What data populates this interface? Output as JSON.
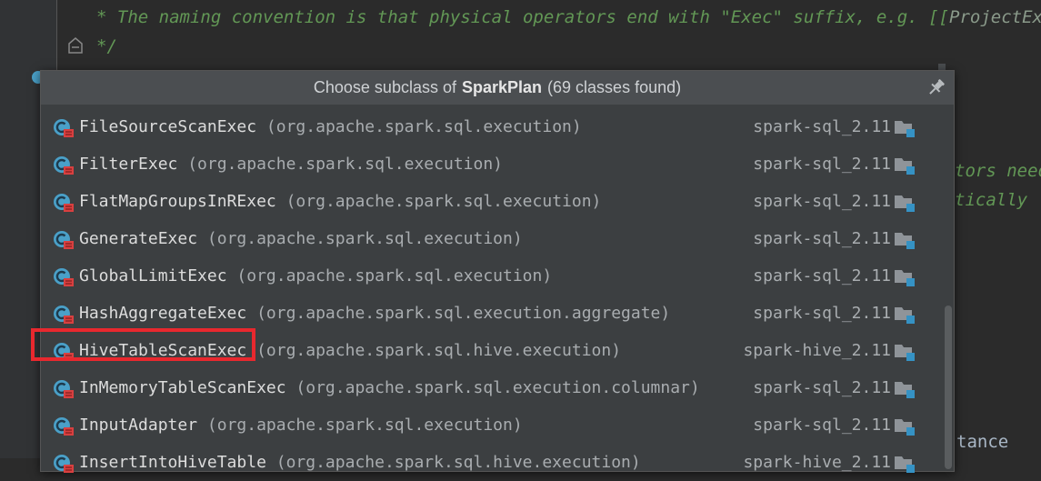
{
  "editor": {
    "line1_prefix": "* The naming convention is that physical operators end with \"Exec\" suffix, e.g. [[",
    "line1_ref": "ProjectExec]",
    "line2": "*/",
    "bg_fragment_1": "tors need",
    "bg_fragment_2": "tically",
    "bg_fragment_3": "tance"
  },
  "popup": {
    "title_prefix": "Choose subclass of",
    "title_class": "SparkPlan",
    "title_suffix": "(69 classes found)",
    "items": [
      {
        "name": "FileSourceScanExec",
        "package": "(org.apache.spark.sql.execution)",
        "module": "spark-sql_2.11"
      },
      {
        "name": "FilterExec",
        "package": "(org.apache.spark.sql.execution)",
        "module": "spark-sql_2.11"
      },
      {
        "name": "FlatMapGroupsInRExec",
        "package": "(org.apache.spark.sql.execution)",
        "module": "spark-sql_2.11"
      },
      {
        "name": "GenerateExec",
        "package": "(org.apache.spark.sql.execution)",
        "module": "spark-sql_2.11"
      },
      {
        "name": "GlobalLimitExec",
        "package": "(org.apache.spark.sql.execution)",
        "module": "spark-sql_2.11"
      },
      {
        "name": "HashAggregateExec",
        "package": "(org.apache.spark.sql.execution.aggregate)",
        "module": "spark-sql_2.11"
      },
      {
        "name": "HiveTableScanExec",
        "package": "(org.apache.spark.sql.hive.execution)",
        "module": "spark-hive_2.11"
      },
      {
        "name": "InMemoryTableScanExec",
        "package": "(org.apache.spark.sql.execution.columnar)",
        "module": "spark-sql_2.11"
      },
      {
        "name": "InputAdapter",
        "package": "(org.apache.spark.sql.execution)",
        "module": "spark-sql_2.11"
      },
      {
        "name": "InsertIntoHiveTable",
        "package": "(org.apache.spark.sql.hive.execution)",
        "module": "spark-hive_2.11"
      }
    ],
    "highlighted_item": "HiveTableScanExec",
    "icons": {
      "class": "class-icon",
      "module": "module-folder-icon",
      "pin": "pin-icon"
    },
    "colors": {
      "highlight": "#e8282e",
      "class_icon": "#4aa0c8",
      "lock": "#d84040"
    }
  }
}
